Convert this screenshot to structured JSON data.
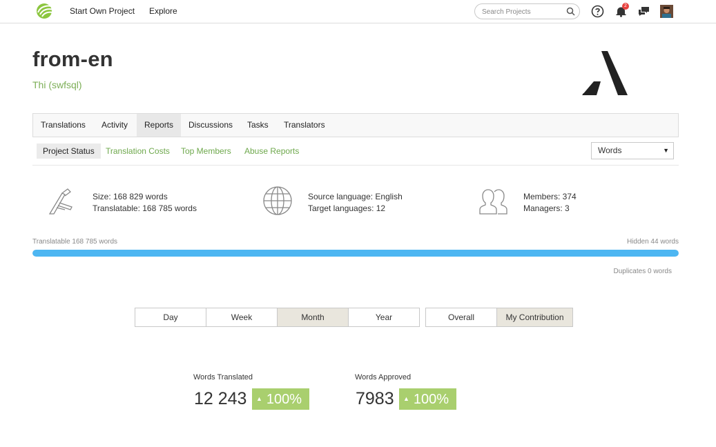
{
  "nav": {
    "start_project": "Start Own Project",
    "explore": "Explore",
    "search_placeholder": "Search Projects",
    "notification_count": "2"
  },
  "project": {
    "title": "from-en",
    "subtitle": "Thi (swfsql)"
  },
  "tabs": [
    {
      "label": "Translations"
    },
    {
      "label": "Activity"
    },
    {
      "label": "Reports"
    },
    {
      "label": "Discussions"
    },
    {
      "label": "Tasks"
    },
    {
      "label": "Translators"
    }
  ],
  "subtabs": [
    {
      "label": "Project Status"
    },
    {
      "label": "Translation Costs"
    },
    {
      "label": "Top Members"
    },
    {
      "label": "Abuse Reports"
    }
  ],
  "unit_select": {
    "selected": "Words"
  },
  "stats": {
    "size": "Size: 168 829 words",
    "translatable": "Translatable: 168 785 words",
    "source_language": "Source language: English",
    "target_languages": "Target languages: 12",
    "members": "Members: 374",
    "managers": "Managers: 3"
  },
  "progress": {
    "left_label": "Translatable 168 785 words",
    "right_label": "Hidden 44 words",
    "duplicates_label": "Duplicates 0 words",
    "fill_fraction": 0.9997
  },
  "periods": [
    {
      "label": "Day"
    },
    {
      "label": "Week"
    },
    {
      "label": "Month"
    },
    {
      "label": "Year"
    }
  ],
  "scopes": [
    {
      "label": "Overall"
    },
    {
      "label": "My Contribution"
    }
  ],
  "metrics": {
    "translated": {
      "label": "Words Translated",
      "value": "12 243",
      "change": "100%"
    },
    "approved": {
      "label": "Words Approved",
      "value": "7983",
      "change": "100%"
    }
  },
  "colors": {
    "accent_green": "#7cae56",
    "progress_blue": "#4db6f2",
    "badge_green": "#a9cf6e",
    "notification_red": "#e8423f"
  }
}
